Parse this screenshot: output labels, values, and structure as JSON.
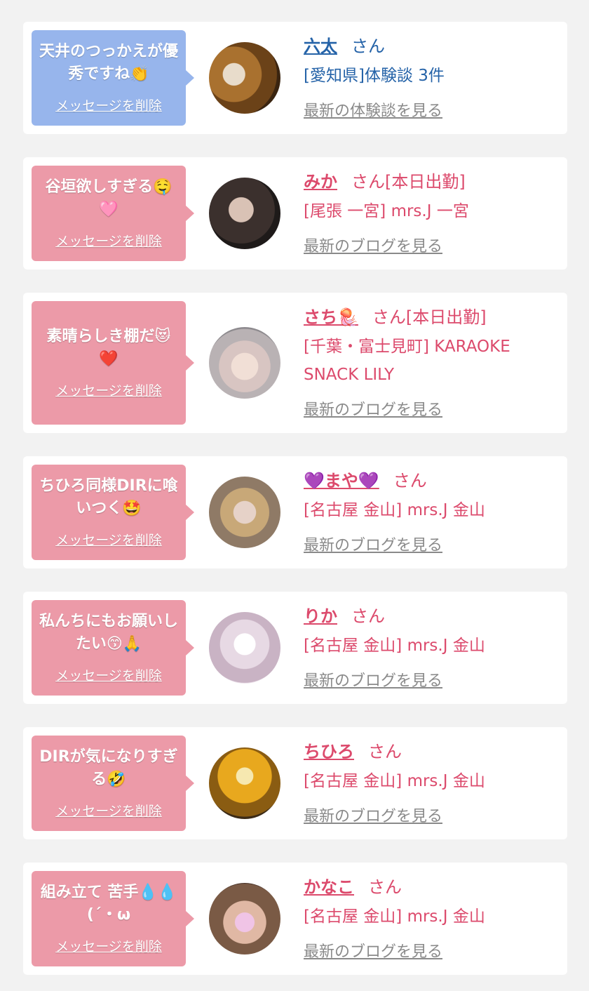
{
  "delete_label": "メッセージを削除",
  "cards": [
    {
      "theme": "blue",
      "message": "天井のつっかえが優秀ですね👏",
      "name": "六太",
      "san": "さん",
      "area": "[愛知県]体験談 3件",
      "link": "最新の体験談を見る"
    },
    {
      "theme": "pink",
      "message": "谷垣欲しすぎる🤤🩷",
      "name": "みか",
      "san": "さん[本日出勤]",
      "area": "[尾張 一宮] mrs.J 一宮",
      "link": "最新のブログを見る"
    },
    {
      "theme": "pink",
      "message": "素晴らしき棚だ😻❤️",
      "name": "さち🪼",
      "san": "さん[本日出勤]",
      "area": "[千葉・富士見町] KARAOKE SNACK LILY",
      "link": "最新のブログを見る"
    },
    {
      "theme": "pink",
      "message": "ちひろ同様DIRに喰いつく🤩",
      "name": "💜まや💜",
      "san": "さん",
      "area": "[名古屋 金山] mrs.J 金山",
      "link": "最新のブログを見る"
    },
    {
      "theme": "pink",
      "message": "私んちにもお願いしたい😙🙏",
      "name": "りか",
      "san": "さん",
      "area": "[名古屋 金山] mrs.J 金山",
      "link": "最新のブログを見る"
    },
    {
      "theme": "pink",
      "message": "DIRが気になりすぎる🤣",
      "name": "ちひろ",
      "san": "さん",
      "area": "[名古屋 金山] mrs.J 金山",
      "link": "最新のブログを見る"
    },
    {
      "theme": "pink",
      "message": "組み立て 苦手💧💧(´・ω",
      "name": "かなこ",
      "san": "さん",
      "area": "[名古屋 金山] mrs.J 金山",
      "link": "最新のブログを見る"
    }
  ],
  "colors": {
    "blue_bubble": "#97b5ec",
    "pink_bubble": "#ec9aa8",
    "blue_text": "#2563a8",
    "pink_text": "#dc4a6c",
    "link_gray": "#8a8a8a",
    "page_bg": "#f2f2f2"
  }
}
